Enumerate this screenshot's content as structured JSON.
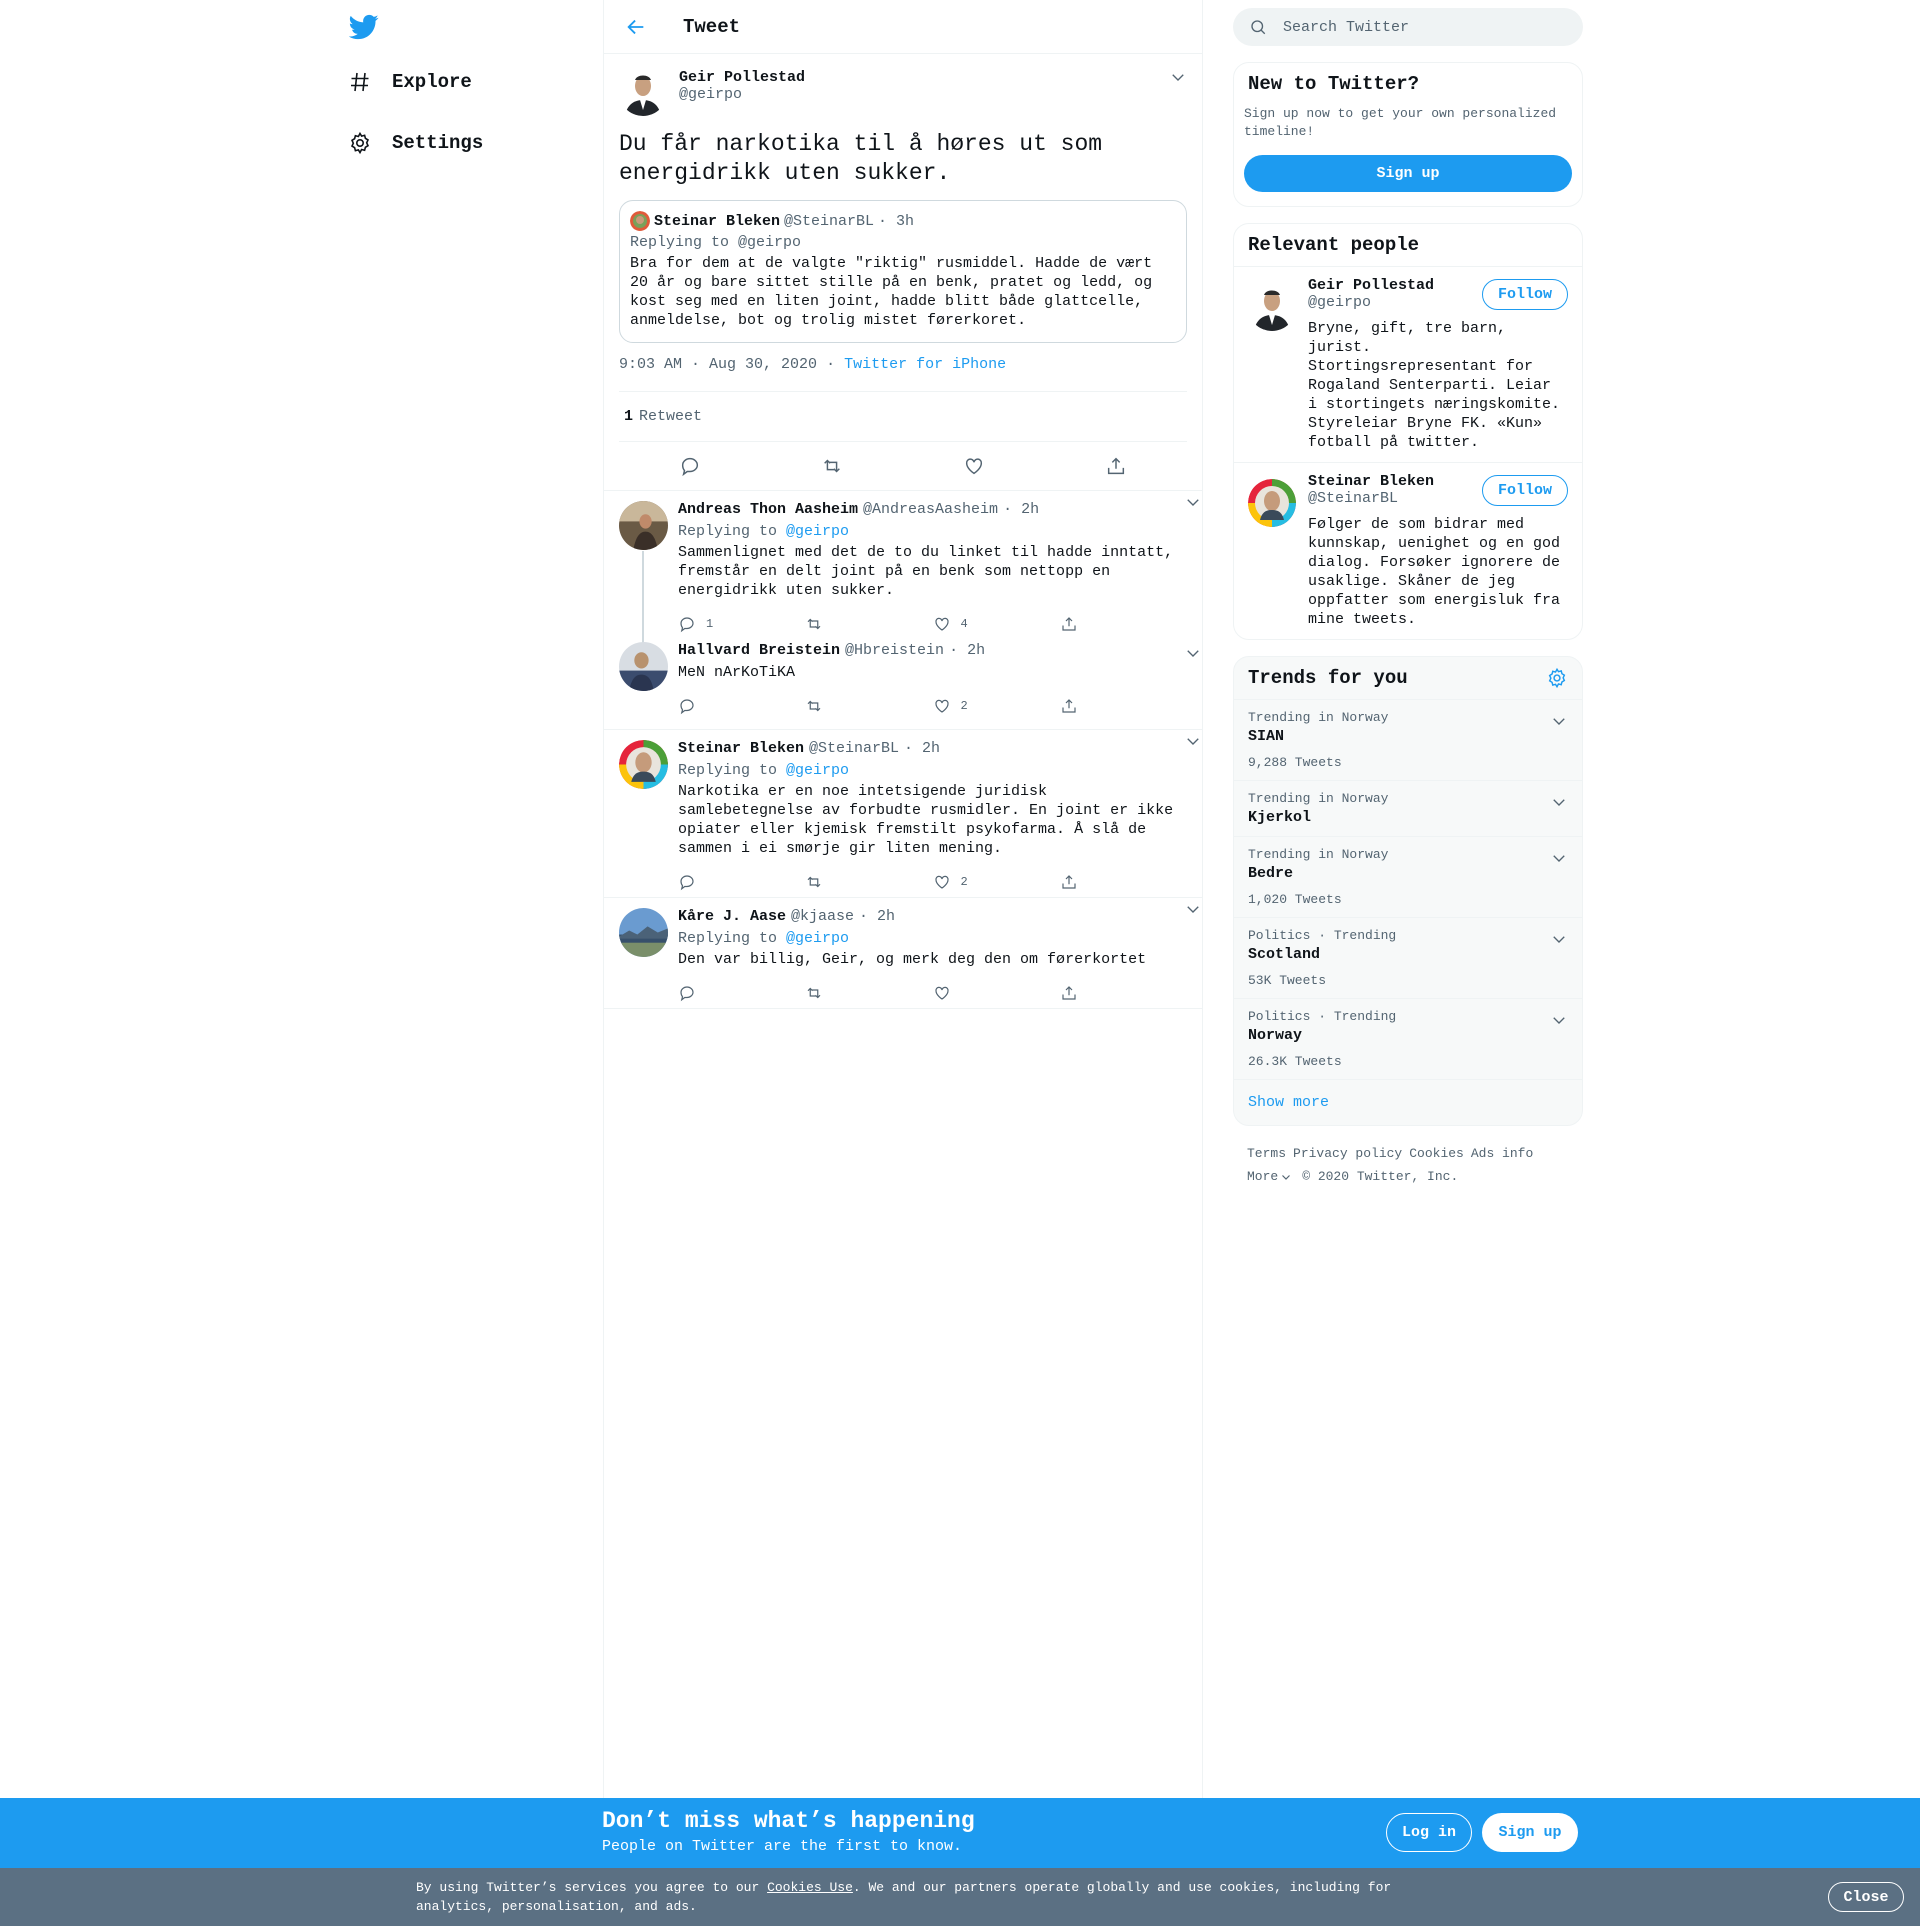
{
  "nav": {
    "logo_icon": "twitter-bird-icon",
    "items": [
      {
        "label": "Explore",
        "icon": "hashtag-icon"
      },
      {
        "label": "Settings",
        "icon": "gear-icon"
      }
    ]
  },
  "header": {
    "title": "Tweet"
  },
  "main_tweet": {
    "name": "Geir Pollestad",
    "handle": "@geirpo",
    "text": "Du får narkotika til å høres ut som energidrikk uten sukker.",
    "quote": {
      "name": "Steinar Bleken",
      "handle": "@SteinarBL",
      "time": "· 3h",
      "replying_to": "Replying to @geirpo",
      "text": "Bra for dem at de valgte \"riktig\" rusmiddel. Hadde de vært 20 år og bare sittet stille på en benk, pratet og ledd, og kost seg med en liten joint, hadde blitt både glattcelle, anmeldelse, bot og trolig mistet førerkoret."
    },
    "time": "9:03 AM · Aug 30, 2020",
    "dot": "·",
    "source": "Twitter for iPhone",
    "retweet_count": "1",
    "retweet_label": "Retweet"
  },
  "replies": [
    {
      "name": "Andreas Thon Aasheim",
      "handle": "@AndreasAasheim",
      "time": "· 2h",
      "replying_prefix": "Replying to",
      "replying_to": "@geirpo",
      "text": "Sammenlignet med det de to du linket til hadde inntatt, fremstår en delt joint på en benk som nettopp en energidrikk uten sukker.",
      "reply_count": "1",
      "like_count": "4"
    },
    {
      "name": "Hallvard Breistein",
      "handle": "@Hbreistein",
      "time": "· 2h",
      "text": "MeN nArKoTiKA",
      "reply_count": "",
      "like_count": "2"
    },
    {
      "name": "Steinar Bleken",
      "handle": "@SteinarBL",
      "time": "· 2h",
      "replying_prefix": "Replying to",
      "replying_to": "@geirpo",
      "text": "Narkotika er en noe intetsigende juridisk samlebetegnelse av forbudte rusmidler. En joint er ikke opiater eller kjemisk fremstilt  psykofarma. Å slå de sammen i ei smørje gir liten mening.",
      "reply_count": "",
      "like_count": "2"
    },
    {
      "name": "Kåre J. Aase",
      "handle": "@kjaase",
      "time": "· 2h",
      "replying_prefix": "Replying to",
      "replying_to": "@geirpo",
      "text": "Den var billig, Geir, og merk deg den om førerkortet",
      "reply_count": "",
      "like_count": ""
    }
  ],
  "search": {
    "placeholder": "Search Twitter"
  },
  "new_to_twitter": {
    "title": "New to Twitter?",
    "subtitle": "Sign up now to get your own personalized timeline!",
    "button": "Sign up"
  },
  "relevant_people": {
    "title": "Relevant people",
    "people": [
      {
        "name": "Geir Pollestad",
        "handle": "@geirpo",
        "bio": "Bryne, gift, tre barn, jurist. Stortingsrepresentant for Rogaland Senterparti. Leiar i stortingets næringskomite. Styreleiar Bryne FK. «Kun» fotball på twitter.",
        "button": "Follow"
      },
      {
        "name": "Steinar Bleken",
        "handle": "@SteinarBL",
        "bio": "Følger de som bidrar med kunnskap, uenighet og en god dialog. Forsøker ignorere de usaklige. Skåner de jeg oppfatter som energisluk fra mine tweets.",
        "button": "Follow"
      }
    ]
  },
  "trends": {
    "title": "Trends for you",
    "items": [
      {
        "context": "Trending in Norway",
        "name": "SIAN",
        "count": "9,288 Tweets"
      },
      {
        "context": "Trending in Norway",
        "name": "Kjerkol",
        "count": ""
      },
      {
        "context": "Trending in Norway",
        "name": "Bedre",
        "count": "1,020 Tweets"
      },
      {
        "context": "Politics · Trending",
        "name": "Scotland",
        "count": "53K Tweets"
      },
      {
        "context": "Politics · Trending",
        "name": "Norway",
        "count": "26.3K Tweets"
      }
    ],
    "show_more": "Show more"
  },
  "footer": {
    "links": [
      "Terms",
      "Privacy policy",
      "Cookies",
      "Ads info"
    ],
    "more": "More",
    "copyright": "© 2020 Twitter, Inc."
  },
  "bottom_bar": {
    "title": "Don’t miss what’s happening",
    "subtitle": "People on Twitter are the first to know.",
    "login": "Log in",
    "signup": "Sign up"
  },
  "cookie_bar": {
    "text_before": "By using Twitter’s services you agree to our ",
    "link": "Cookies Use",
    "text_after": ". We and our partners operate globally and use cookies, including for analytics, personalisation, and ads.",
    "close": "Close"
  },
  "colors": {
    "accent": "#1d9bf0",
    "muted": "#536471",
    "cookie_bg": "#5b7083"
  }
}
